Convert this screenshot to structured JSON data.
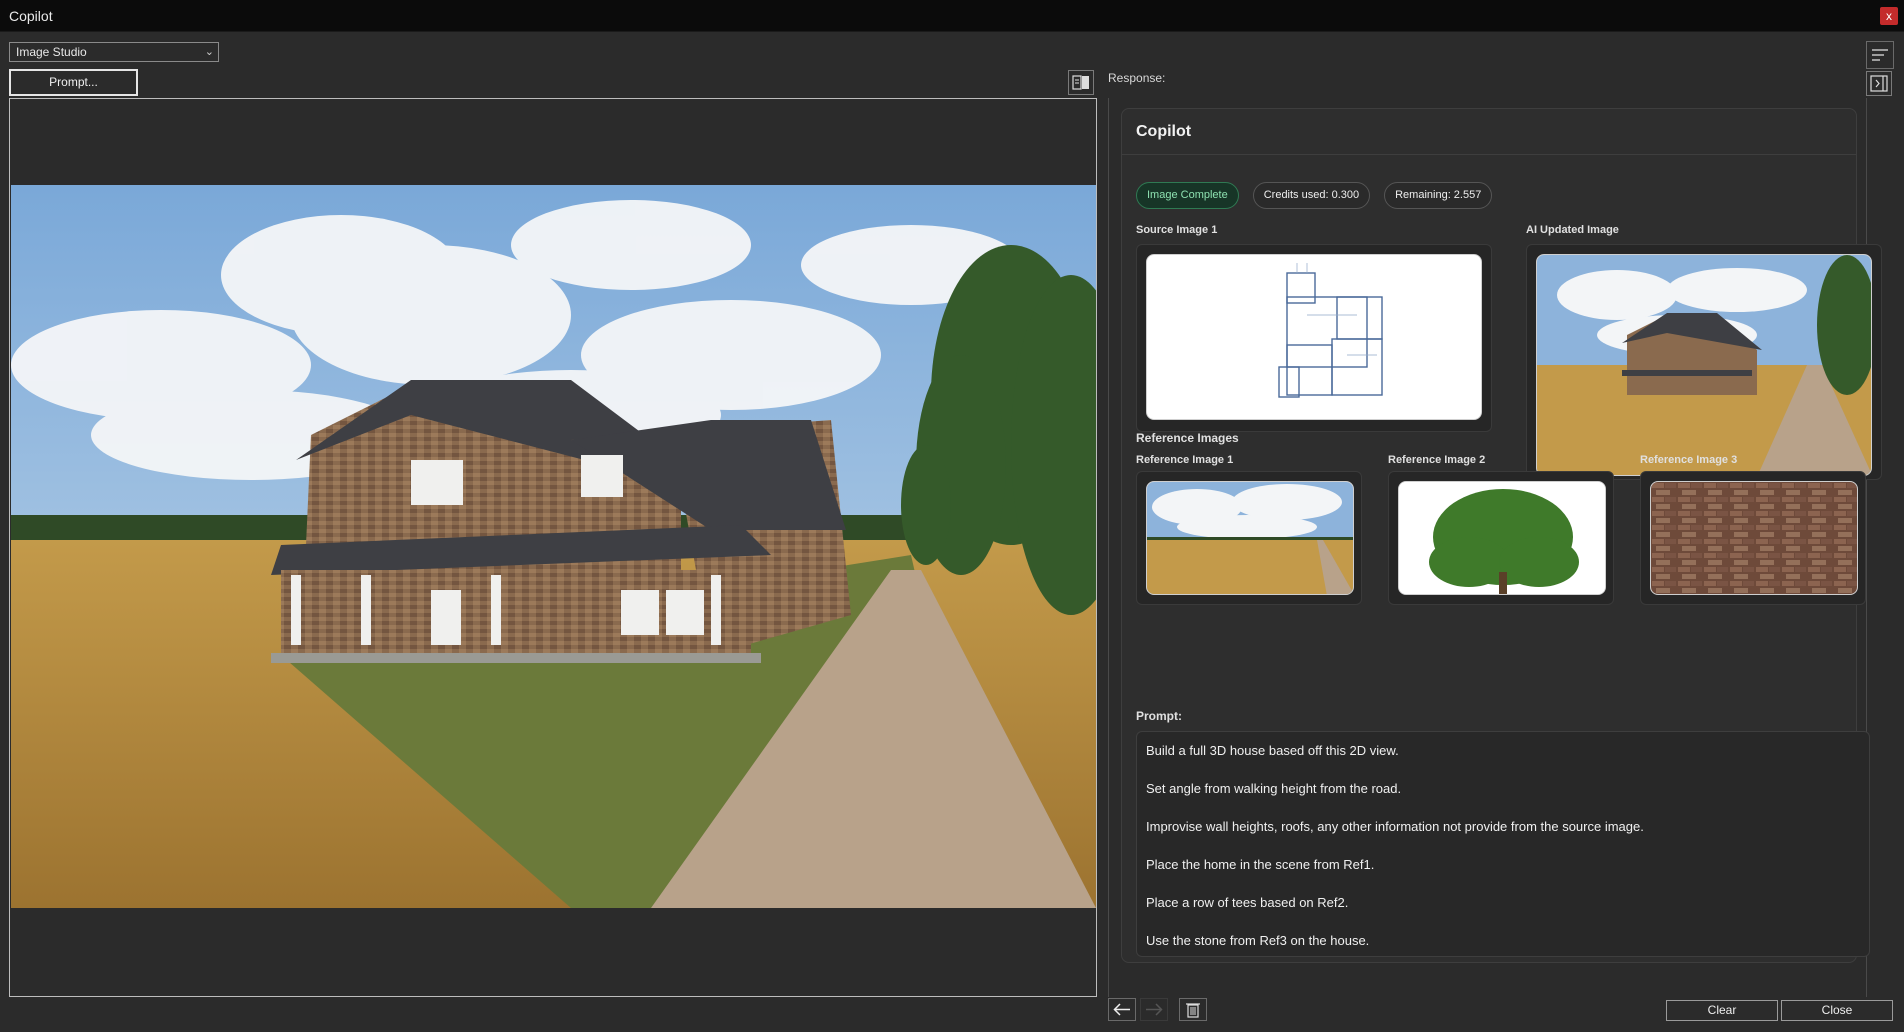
{
  "window": {
    "title": "Copilot",
    "close_label": "x"
  },
  "toolbar": {
    "mode_value": "Image Studio",
    "prompt_button": "Prompt...",
    "response_label": "Response:"
  },
  "panel": {
    "title": "Copilot",
    "badges": {
      "status": "Image Complete",
      "credits_used": "Credits used: 0.300",
      "remaining": "Remaining: 2.557"
    },
    "source_label": "Source Image 1",
    "updated_label": "AI Updated Image",
    "reference_heading": "Reference Images",
    "references": [
      "Reference Image 1",
      "Reference Image 2",
      "Reference Image 3"
    ],
    "prompt_label": "Prompt:",
    "prompt_lines": [
      "Build a full 3D house based off this 2D view.",
      "Set angle from walking height from the road.",
      "Improvise wall heights, roofs, any other information not provide from the source image.",
      "Place the home in the scene from Ref1.",
      "Place a row of tees based on Ref2.",
      "Use the stone from Ref3 on the house."
    ]
  },
  "footer": {
    "clear": "Clear",
    "close": "Close"
  },
  "colors": {
    "accent_green": "#2f7a53",
    "close_red": "#c42b2b",
    "bg": "#2b2b2b"
  }
}
